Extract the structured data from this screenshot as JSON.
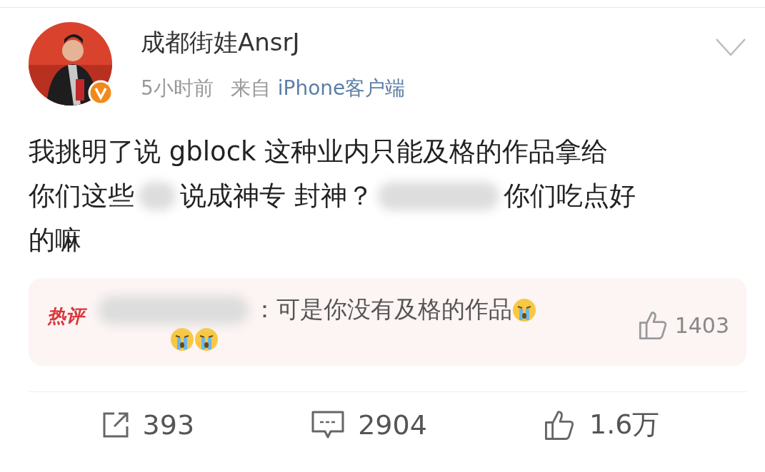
{
  "post": {
    "author": "成都街娃AnsrJ",
    "verified": true,
    "time": "5小时前",
    "source_prefix": "来自",
    "source": "iPhone客户端",
    "body_lines": [
      [
        {
          "kind": "text",
          "text": "我挑明了说 gblock 这种业内只能及格的作品拿给"
        }
      ],
      [
        {
          "kind": "text",
          "text": "你们这些"
        },
        {
          "kind": "blur",
          "wide": false
        },
        {
          "kind": "text",
          "text": "说成神专 封神？"
        },
        {
          "kind": "blur",
          "wide": true
        },
        {
          "kind": "text",
          "text": "你们吃点好"
        }
      ],
      [
        {
          "kind": "text",
          "text": "的嘛"
        }
      ]
    ],
    "hot_comment": {
      "badge": "热评",
      "author_hidden": true,
      "separator": "：",
      "text": "可是你没有及格的作品",
      "emojis_inline": [
        {
          "kind": "crying"
        }
      ],
      "emojis_below": [
        {
          "kind": "crying"
        },
        {
          "kind": "crying"
        }
      ],
      "likes": "1403"
    },
    "actions": [
      {
        "kind": "share",
        "count": "393"
      },
      {
        "kind": "comment",
        "count": "2904"
      },
      {
        "kind": "like",
        "count": "1.6万"
      }
    ]
  }
}
